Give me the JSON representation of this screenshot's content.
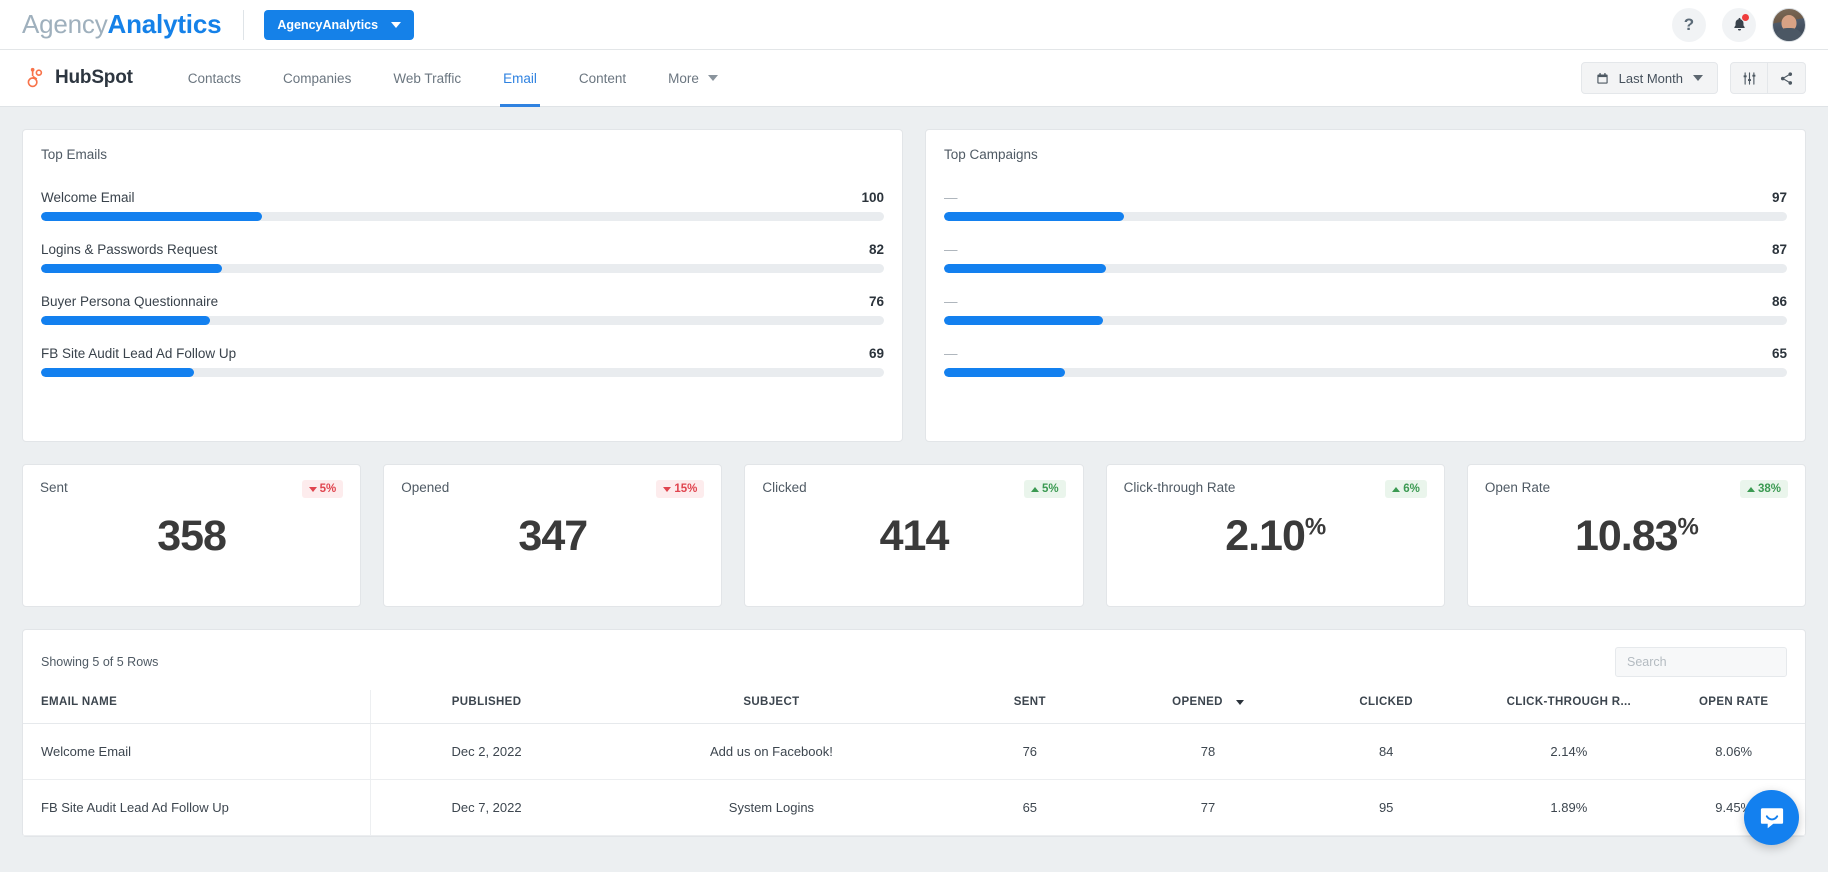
{
  "header": {
    "brand_light": "Agency",
    "brand_bold": "Analytics",
    "account_button": "AgencyAnalytics",
    "help_icon": "question-mark-icon",
    "notifications_icon": "bell-icon",
    "avatar_icon": "user-avatar"
  },
  "subnav": {
    "integration": "HubSpot",
    "integration_icon": "hubspot-logo-icon",
    "tabs": [
      {
        "label": "Contacts",
        "active": false
      },
      {
        "label": "Companies",
        "active": false
      },
      {
        "label": "Web Traffic",
        "active": false
      },
      {
        "label": "Email",
        "active": true
      },
      {
        "label": "Content",
        "active": false
      },
      {
        "label": "More",
        "active": false,
        "has_caret": true
      }
    ],
    "date_range": "Last Month",
    "date_range_icon": "calendar-icon",
    "filter_icon": "sliders-icon",
    "share_icon": "share-icon"
  },
  "chart_data": [
    {
      "type": "bar",
      "title": "Top Emails",
      "orientation": "horizontal",
      "categories": [
        "Welcome Email",
        "Logins & Passwords Request",
        "Buyer Persona Questionnaire",
        "FB Site Audit Lead Ad Follow Up"
      ],
      "values": [
        100,
        82,
        76,
        69
      ],
      "fill_percents": [
        26.2,
        21.5,
        20.0,
        18.2
      ],
      "xlabel": "",
      "ylabel": "",
      "grid": false,
      "legend": "none",
      "accent_color": "#1380ef",
      "track_color": "#e9ecef"
    },
    {
      "type": "bar",
      "title": "Top Campaigns",
      "orientation": "horizontal",
      "categories": [
        "—",
        "—",
        "—",
        "—"
      ],
      "values": [
        97,
        87,
        86,
        65
      ],
      "fill_percents": [
        21.4,
        19.2,
        18.9,
        14.3
      ],
      "xlabel": "",
      "ylabel": "",
      "grid": false,
      "legend": "none",
      "accent_color": "#1380ef",
      "track_color": "#e9ecef"
    }
  ],
  "kpis": [
    {
      "label": "Sent",
      "value": "358",
      "unit": "",
      "delta": "5%",
      "direction": "down"
    },
    {
      "label": "Opened",
      "value": "347",
      "unit": "",
      "delta": "15%",
      "direction": "down"
    },
    {
      "label": "Clicked",
      "value": "414",
      "unit": "",
      "delta": "5%",
      "direction": "up"
    },
    {
      "label": "Click-through Rate",
      "value": "2.10",
      "unit": "%",
      "delta": "6%",
      "direction": "up"
    },
    {
      "label": "Open Rate",
      "value": "10.83",
      "unit": "%",
      "delta": "38%",
      "direction": "up"
    }
  ],
  "table": {
    "rows_info": "Showing 5 of 5 Rows",
    "search_placeholder": "Search",
    "search_value": "",
    "sorted_column": "OPENED",
    "sort_direction": "desc",
    "columns": [
      "EMAIL NAME",
      "PUBLISHED",
      "SUBJECT",
      "SENT",
      "OPENED",
      "CLICKED",
      "CLICK-THROUGH R...",
      "OPEN RATE"
    ],
    "rows": [
      {
        "email_name": "Welcome Email",
        "published": "Dec 2, 2022",
        "subject": "Add us on Facebook!",
        "sent": "76",
        "opened": "78",
        "clicked": "84",
        "ctr": "2.14%",
        "open_rate": "8.06%"
      },
      {
        "email_name": "FB Site Audit Lead Ad Follow Up",
        "published": "Dec 7, 2022",
        "subject": "System Logins",
        "sent": "65",
        "opened": "77",
        "clicked": "95",
        "ctr": "1.89%",
        "open_rate": "9.45%"
      }
    ]
  },
  "chat": {
    "icon": "intercom-chat-icon"
  }
}
